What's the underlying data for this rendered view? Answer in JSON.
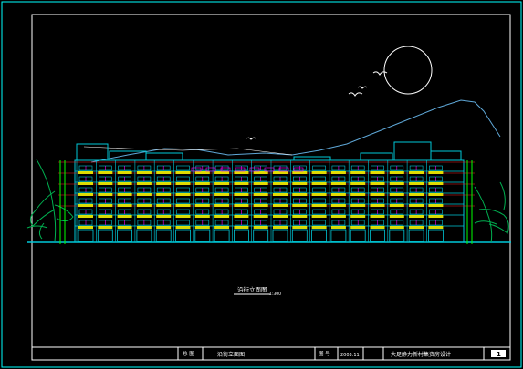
{
  "drawing": {
    "title": "沿街立面图",
    "scale": "1:300"
  },
  "title_block": {
    "stamp_1": "总 图",
    "drawing_name": "沿街立面图",
    "stamp_2": "图 号",
    "date": "2003.11",
    "project_name": "大足静力新村集资房设计",
    "sheet_number": "1"
  },
  "colors": {
    "background": "#000000",
    "frame": "#00ffff",
    "building_cyan": "#00c8d8",
    "building_magenta": "#ff00ff",
    "balcony_yellow": "#ffff00",
    "level_red": "#ff2020",
    "tree_green": "#00b050",
    "sky_line": "#5fa8d8",
    "white": "#ffffff"
  }
}
